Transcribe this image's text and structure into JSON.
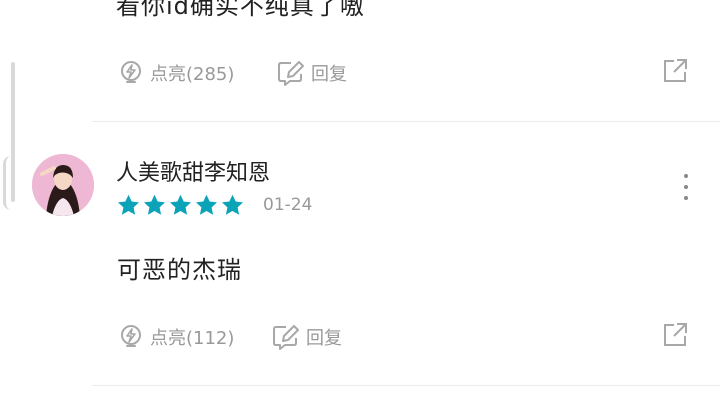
{
  "previous_comment": {
    "text_cut_off": "看你id确实不纯真了嗷",
    "like_label": "点亮(285)",
    "reply_label": "回复"
  },
  "comment": {
    "username": "人美歌甜李知恩",
    "rating_stars": 5,
    "date": "01-24",
    "text": "可恶的杰瑞",
    "like_label": "点亮(112)",
    "reply_label": "回复"
  },
  "colors": {
    "star": "#0aa3b7",
    "muted_text": "#999999",
    "divider": "#ececec"
  },
  "icons": [
    "lightning-icon",
    "edit-reply-icon",
    "share-icon",
    "more-vert-icon",
    "star-icon"
  ]
}
